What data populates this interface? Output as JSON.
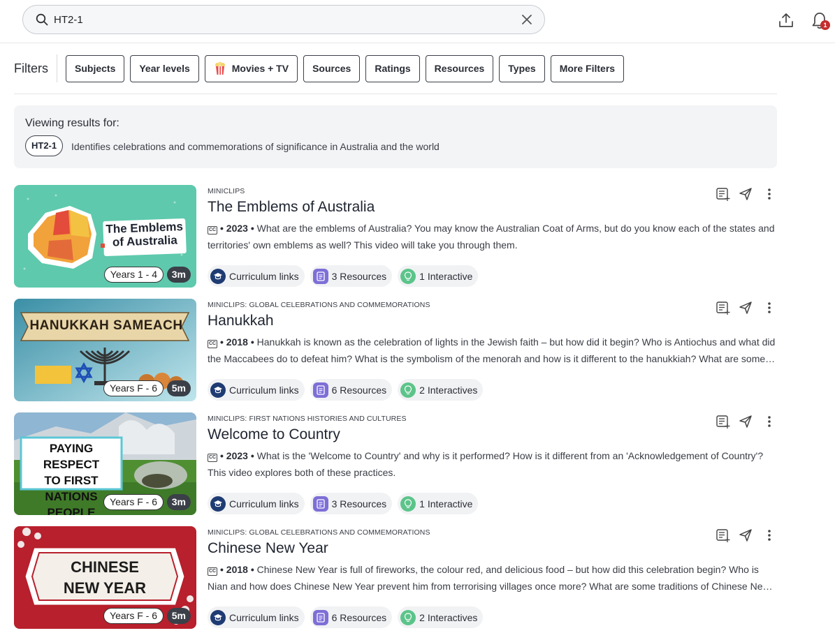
{
  "search": {
    "value": "HT2-1",
    "placeholder": ""
  },
  "notifications": {
    "count": "1"
  },
  "filters": {
    "label": "Filters",
    "buttons": [
      "Subjects",
      "Year levels",
      "Movies + TV",
      "Sources",
      "Ratings",
      "Resources",
      "Types",
      "More Filters"
    ]
  },
  "viewing": {
    "title": "Viewing results for:",
    "code": "HT2-1",
    "description": "Identifies celebrations and commemorations of significance in Australia and the world"
  },
  "results": [
    {
      "source": "MINICLIPS",
      "title": "The Emblems of Australia",
      "year": "2023",
      "description": "What are the emblems of Australia? You may know the Australian Coat of Arms, but do you know each of the states and territories' own emblems as well? This video will take you through them.",
      "years": "Years 1 - 4",
      "duration": "3m",
      "thumb_text": [
        "The Emblems",
        "of Australia"
      ],
      "curriculum": "Curriculum links",
      "resources": "3 Resources",
      "interactives": "1 Interactive"
    },
    {
      "source": "MINICLIPS: GLOBAL CELEBRATIONS AND COMMEMORATIONS",
      "title": "Hanukkah",
      "year": "2018",
      "description": "Hanukkah is known as the celebration of lights in the Jewish faith – but how did it begin? Who is Antiochus and what did the Maccabees do to defeat him? What is the symbolism of the menorah and how is it different to the hanukkiah? What are some traditions of Hanukkah?",
      "years": "Years F - 6",
      "duration": "5m",
      "thumb_text": [
        "HANUKKAH SAMEACH"
      ],
      "curriculum": "Curriculum links",
      "resources": "6 Resources",
      "interactives": "2 Interactives"
    },
    {
      "source": "MINICLIPS: FIRST NATIONS HISTORIES AND CULTURES",
      "title": "Welcome to Country",
      "year": "2023",
      "description": "What is the 'Welcome to Country' and why is it performed? How is it different from an 'Acknowledgement of Country'? This video explores both of these practices.",
      "years": "Years F - 6",
      "duration": "3m",
      "thumb_text": [
        "PAYING RESPECT",
        "TO FIRST",
        "NATIONS PEOPLE"
      ],
      "curriculum": "Curriculum links",
      "resources": "3 Resources",
      "interactives": "1 Interactive"
    },
    {
      "source": "MINICLIPS: GLOBAL CELEBRATIONS AND COMMEMORATIONS",
      "title": "Chinese New Year",
      "year": "2018",
      "description": "Chinese New Year is full of fireworks, the colour red, and delicious food – but how did this celebration begin? Who is Nian and how does Chinese New Year prevent him from terrorising villages once more? What are some traditions of Chinese New Year?",
      "years": "Years F - 6",
      "duration": "5m",
      "thumb_text": [
        "CHINESE",
        "NEW YEAR"
      ],
      "curriculum": "Curriculum links",
      "resources": "6 Resources",
      "interactives": "2 Interactives"
    }
  ]
}
